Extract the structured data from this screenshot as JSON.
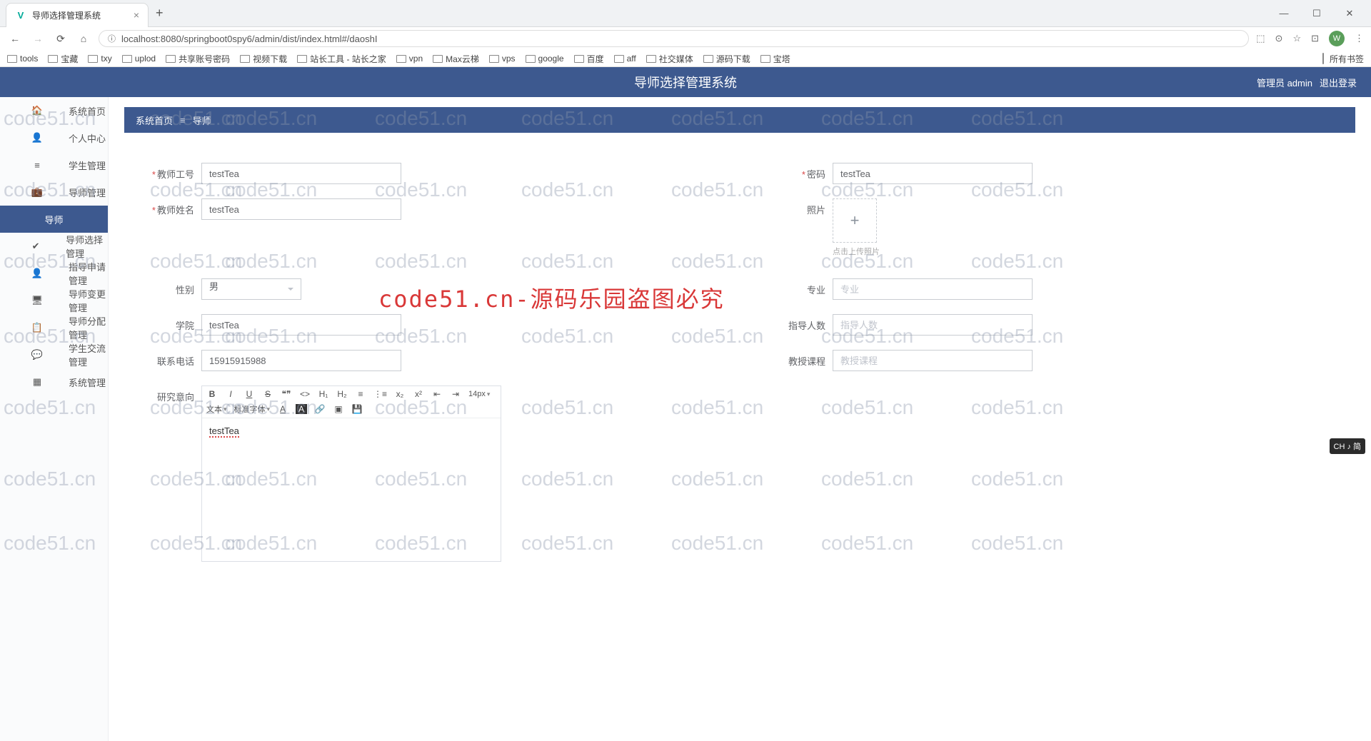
{
  "browser": {
    "tab_title": "导师选择管理系统",
    "url": "localhost:8080/springboot0spy6/admin/dist/index.html#/daoshI",
    "bookmarks": [
      "tools",
      "宝藏",
      "txy",
      "uplod",
      "共享账号密码",
      "视频下载",
      "站长工具 - 站长之家",
      "vpn",
      "Max云梯",
      "vps",
      "google",
      "百度",
      "aff",
      "社交媒体",
      "源码下载",
      "宝塔"
    ],
    "bookmarks_right": "所有书签",
    "win_avatar": "W"
  },
  "app": {
    "title": "导师选择管理系统",
    "role_user": "管理员 admin",
    "logout": "退出登录"
  },
  "sidebar": {
    "items": [
      {
        "icon": "home",
        "label": "系统首页"
      },
      {
        "icon": "user",
        "label": "个人中心"
      },
      {
        "icon": "list",
        "label": "学生管理"
      },
      {
        "icon": "briefcase",
        "label": "导师管理"
      },
      {
        "icon": "",
        "label": "导师",
        "active": true
      },
      {
        "icon": "check",
        "label": "导师选择管理"
      },
      {
        "icon": "user2",
        "label": "指导申请管理"
      },
      {
        "icon": "monitor",
        "label": "导师变更管理"
      },
      {
        "icon": "assign",
        "label": "导师分配管理"
      },
      {
        "icon": "chat",
        "label": "学生交流管理"
      },
      {
        "icon": "grid",
        "label": "系统管理"
      }
    ]
  },
  "breadcrumb": {
    "home": "系统首页",
    "current": "导师"
  },
  "form": {
    "teacher_id": {
      "label": "教师工号",
      "value": "testTea"
    },
    "password": {
      "label": "密码",
      "value": "testTea"
    },
    "teacher_name": {
      "label": "教师姓名",
      "value": "testTea"
    },
    "photo": {
      "label": "照片",
      "tip": "点击上传照片"
    },
    "gender": {
      "label": "性别",
      "value": "男"
    },
    "major": {
      "label": "专业",
      "placeholder": "专业"
    },
    "college": {
      "label": "学院",
      "value": "testTea"
    },
    "quota": {
      "label": "指导人数",
      "placeholder": "指导人数"
    },
    "phone": {
      "label": "联系电话",
      "value": "15915915988"
    },
    "course": {
      "label": "教授课程",
      "placeholder": "教授课程"
    },
    "research": {
      "label": "研究意向",
      "content": "testTea"
    }
  },
  "editor": {
    "font_size": "14px",
    "text_style": "文本",
    "font_family": "标准字体"
  },
  "watermark": {
    "text": "code51.cn",
    "center": "code51.cn-源码乐园盗图必究"
  },
  "ime": "CH ♪ 简"
}
